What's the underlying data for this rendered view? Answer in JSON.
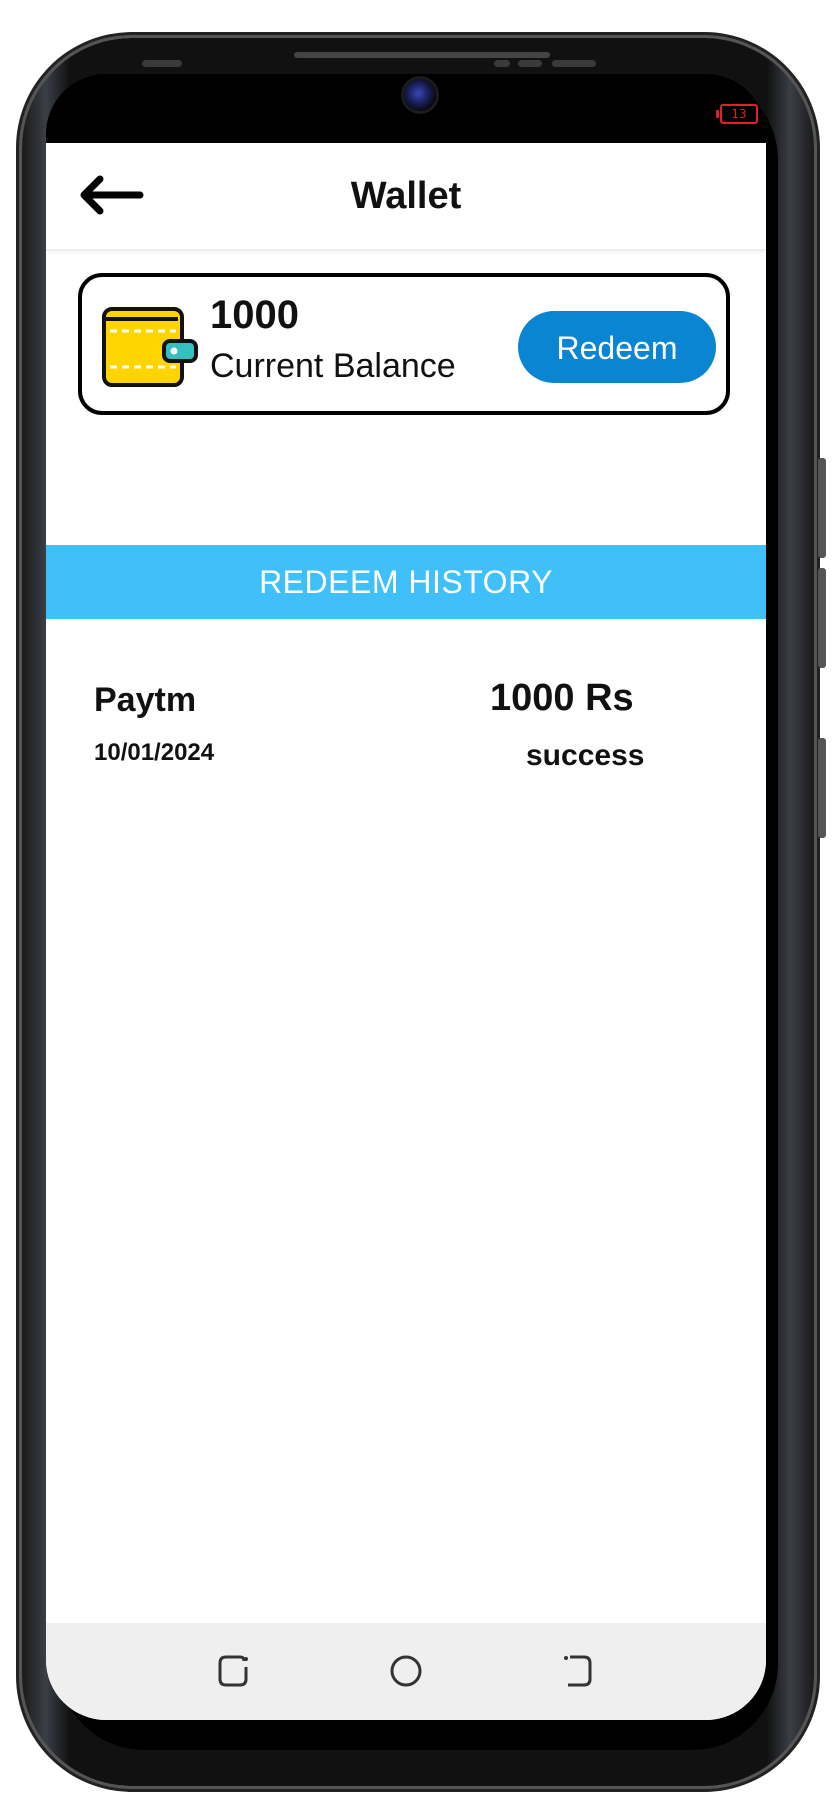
{
  "status_bar": {
    "battery": "13"
  },
  "app_bar": {
    "title": "Wallet",
    "back_icon": "arrow-left-icon"
  },
  "balance_card": {
    "amount": "1000",
    "label": "Current Balance",
    "redeem_label": "Redeem",
    "icon": "wallet-icon"
  },
  "history": {
    "header": "REDEEM HISTORY",
    "items": [
      {
        "provider": "Paytm",
        "date": "10/01/2024",
        "amount": "1000 Rs",
        "status": "success"
      }
    ]
  },
  "nav_bar": {
    "icons": [
      "recents-icon",
      "home-icon",
      "back-icon"
    ]
  },
  "colors": {
    "accent_blue": "#0a85d1",
    "banner_blue": "#40c0fa",
    "wallet_yellow": "#ffd400",
    "battery_red": "#e0202a"
  }
}
